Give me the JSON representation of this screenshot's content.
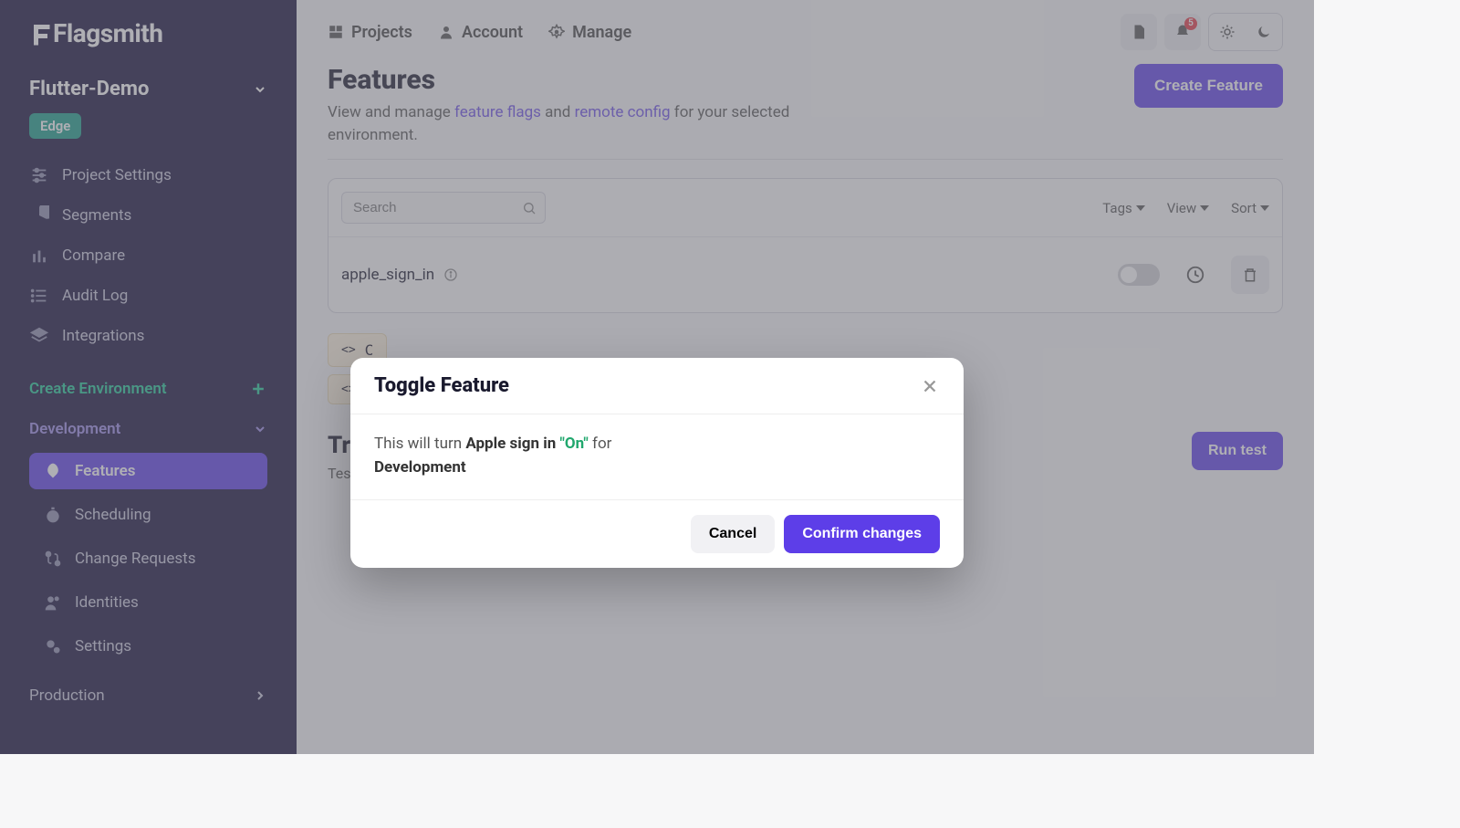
{
  "brand": "Flagsmith",
  "sidebar": {
    "project_name": "Flutter-Demo",
    "edge_badge": "Edge",
    "items": [
      {
        "label": "Project Settings"
      },
      {
        "label": "Segments"
      },
      {
        "label": "Compare"
      },
      {
        "label": "Audit Log"
      },
      {
        "label": "Integrations"
      }
    ],
    "create_env": "Create Environment",
    "env_name": "Development",
    "env_items": [
      {
        "label": "Features"
      },
      {
        "label": "Scheduling"
      },
      {
        "label": "Change Requests"
      },
      {
        "label": "Identities"
      },
      {
        "label": "Settings"
      }
    ],
    "prod": "Production"
  },
  "topnav": {
    "projects": "Projects",
    "account": "Account",
    "manage": "Manage",
    "notif_count": "5"
  },
  "page": {
    "title": "Features",
    "subtitle_pre": "View and manage ",
    "link_flags": "feature flags",
    "subtitle_mid": " and ",
    "link_remote": "remote config",
    "subtitle_post": " for your selected environment.",
    "create_button": "Create Feature"
  },
  "filters": {
    "search_placeholder": "Search",
    "tags": "Tags",
    "view": "View",
    "sort": "Sort"
  },
  "feature": {
    "name": "apple_sign_in"
  },
  "try": {
    "title": "Try it out",
    "text": "Test",
    "run": "Run test"
  },
  "modal": {
    "title": "Toggle Feature",
    "body_pre": "This will turn ",
    "body_flag": "Apple sign in",
    "body_on": "\"On\"",
    "body_for": " for ",
    "body_env": "Development",
    "cancel": "Cancel",
    "confirm": "Confirm changes"
  }
}
